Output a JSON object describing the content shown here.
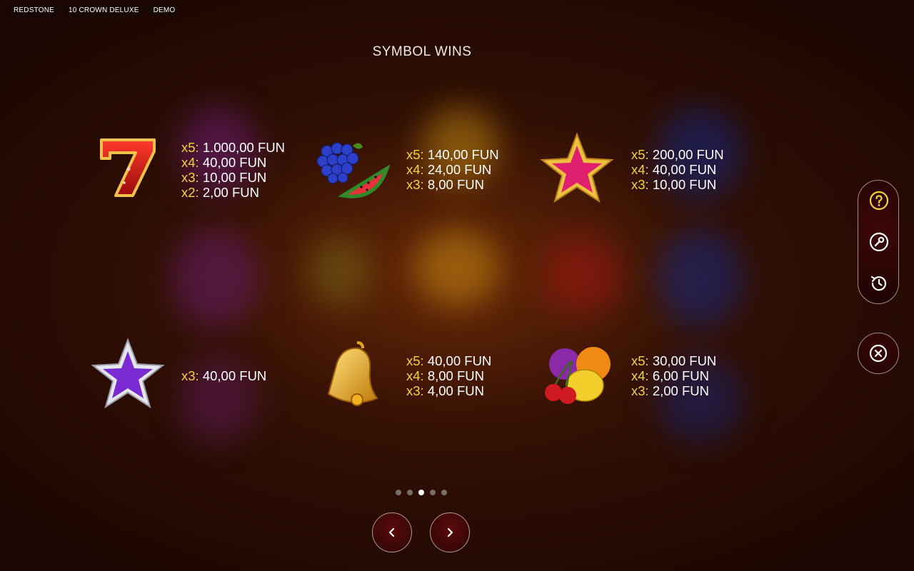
{
  "header": {
    "provider": "REDSTONE",
    "game": "10 CROWN DELUXE",
    "mode": "DEMO"
  },
  "title": "SYMBOL WINS",
  "symbols": [
    {
      "icon": "seven-icon",
      "lines": [
        {
          "m": "x5:",
          "v": " 1.000,00 FUN"
        },
        {
          "m": "x4:",
          "v": " 40,00 FUN"
        },
        {
          "m": "x3:",
          "v": " 10,00 FUN"
        },
        {
          "m": "x2:",
          "v": " 2,00 FUN"
        }
      ]
    },
    {
      "icon": "grapes-watermelon-icon",
      "lines": [
        {
          "m": "x5:",
          "v": " 140,00 FUN"
        },
        {
          "m": "x4:",
          "v": " 24,00 FUN"
        },
        {
          "m": "x3:",
          "v": " 8,00 FUN"
        }
      ]
    },
    {
      "icon": "red-star-icon",
      "lines": [
        {
          "m": "x5:",
          "v": " 200,00 FUN"
        },
        {
          "m": "x4:",
          "v": " 40,00 FUN"
        },
        {
          "m": "x3:",
          "v": " 10,00 FUN"
        }
      ]
    },
    {
      "icon": "purple-star-icon",
      "lines": [
        {
          "m": "x3:",
          "v": " 40,00 FUN"
        }
      ]
    },
    {
      "icon": "bell-icon",
      "lines": [
        {
          "m": "x5:",
          "v": " 40,00 FUN"
        },
        {
          "m": "x4:",
          "v": " 8,00 FUN"
        },
        {
          "m": "x3:",
          "v": " 4,00 FUN"
        }
      ]
    },
    {
      "icon": "mixed-fruit-icon",
      "lines": [
        {
          "m": "x5:",
          "v": " 30,00 FUN"
        },
        {
          "m": "x4:",
          "v": " 6,00 FUN"
        },
        {
          "m": "x3:",
          "v": " 2,00 FUN"
        }
      ]
    }
  ],
  "pagination": {
    "total": 5,
    "current": 3
  },
  "nav": {
    "prev_icon": "chevron-left-icon",
    "next_icon": "chevron-right-icon"
  },
  "side_menu": [
    {
      "icon": "help-icon"
    },
    {
      "icon": "settings-wrench-icon"
    },
    {
      "icon": "history-icon"
    }
  ],
  "close_icon": "close-icon",
  "colors": {
    "multiplier": "#f3d23a",
    "text": "#ffffff",
    "background": "#2c0d03"
  }
}
